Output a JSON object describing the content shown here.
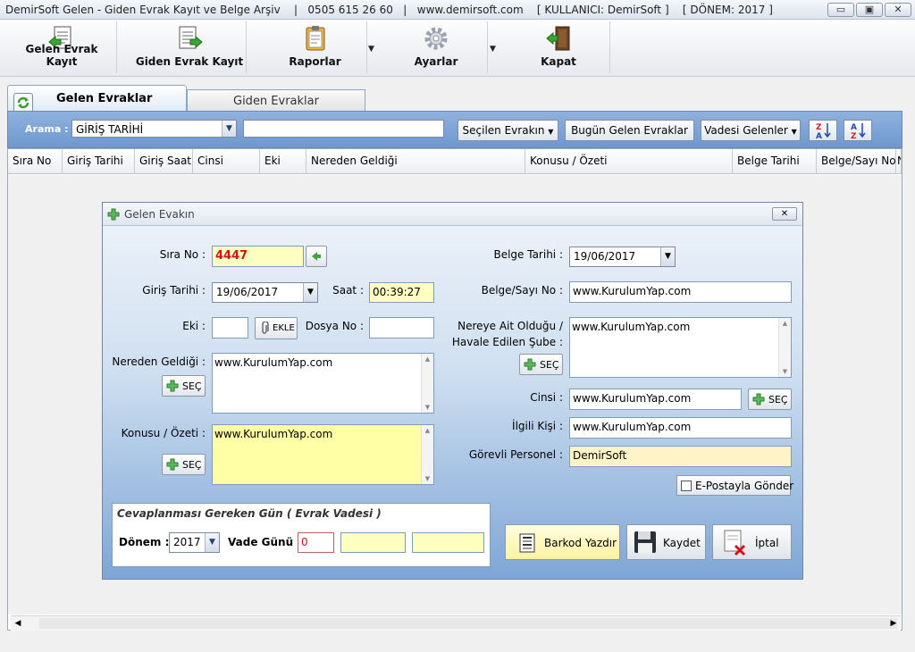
{
  "window": {
    "title": "DemirSoft Gelen - Giden Evrak Kayıt ve Belge Arşiv    |   0505 615 26 60   |   www.demirsoft.com    [ KULLANICI: DemirSoft ]    [ DÖNEM: 2017 ]",
    "min": "▭",
    "max": "▣",
    "close": "✕"
  },
  "toolbar": {
    "gelen": "Gelen Evrak Kayıt",
    "giden": "Giden Evrak Kayıt",
    "raporlar": "Raporlar",
    "ayarlar": "Ayarlar",
    "kapat": "Kapat",
    "drop": "▼"
  },
  "tabs": {
    "gelen": "Gelen Evraklar",
    "giden": "Giden Evraklar"
  },
  "search": {
    "label": "Arama :",
    "field": "GİRİŞ TARİHİ",
    "query": "",
    "secilen": "Seçilen Evrakın",
    "bugun": "Bugün Gelen Evraklar",
    "vadesi": "Vadesi Gelenler",
    "arrow": "▼"
  },
  "grid": {
    "columns": [
      "Sıra No",
      "Giriş Tarihi",
      "Giriş Saati",
      "Cinsi",
      "Eki",
      "Nereden Geldiği",
      "Konusu / Özeti",
      "Belge Tarihi",
      "Belge/Sayı No",
      "N"
    ]
  },
  "dialog": {
    "title": "Gelen Evakın",
    "close": "✕",
    "sira_label": "Sıra No :",
    "sira": "4447",
    "giris_tarihi_label": "Giriş Tarihi :",
    "giris_tarihi": "19/06/2017",
    "saat_label": "Saat :",
    "saat": "00:39:27",
    "eki_label": "Eki :",
    "eki": "",
    "ekle": "EKLE",
    "dosya_label": "Dosya No :",
    "dosya": "",
    "nereden_label": "Nereden Geldiği :",
    "nereden": "www.KurulumYap.com",
    "konusu_label": "Konusu / Özeti :",
    "konusu": "www.KurulumYap.com",
    "sec": "SEÇ",
    "belge_tarihi_label": "Belge Tarihi :",
    "belge_tarihi": "19/06/2017",
    "belge_sayi_label": "Belge/Sayı No :",
    "belge_sayi": "www.KurulumYap.com",
    "nereye_label1": "Nereye Ait Olduğu /",
    "nereye_label2": "Havale Edilen Şube :",
    "nereye": "www.KurulumYap.com",
    "cinsi_label": "Cinsi :",
    "cinsi": "www.KurulumYap.com",
    "ilgili_label": "İlgili Kişi :",
    "ilgili": "www.KurulumYap.com",
    "gorevli_label": "Görevli Personel :",
    "gorevli": "DemirSoft",
    "email": "E-Postayla Gönder",
    "vade_title": "Cevaplanması Gereken Gün  ( Evrak Vadesi )",
    "donem_label": "Dönem :",
    "donem": "2017",
    "vade_label": "Vade Günü :",
    "vade": "0",
    "barkod": "Barkod Yazdır",
    "kaydet": "Kaydet",
    "iptal": "İptal",
    "arrow": "▼"
  }
}
